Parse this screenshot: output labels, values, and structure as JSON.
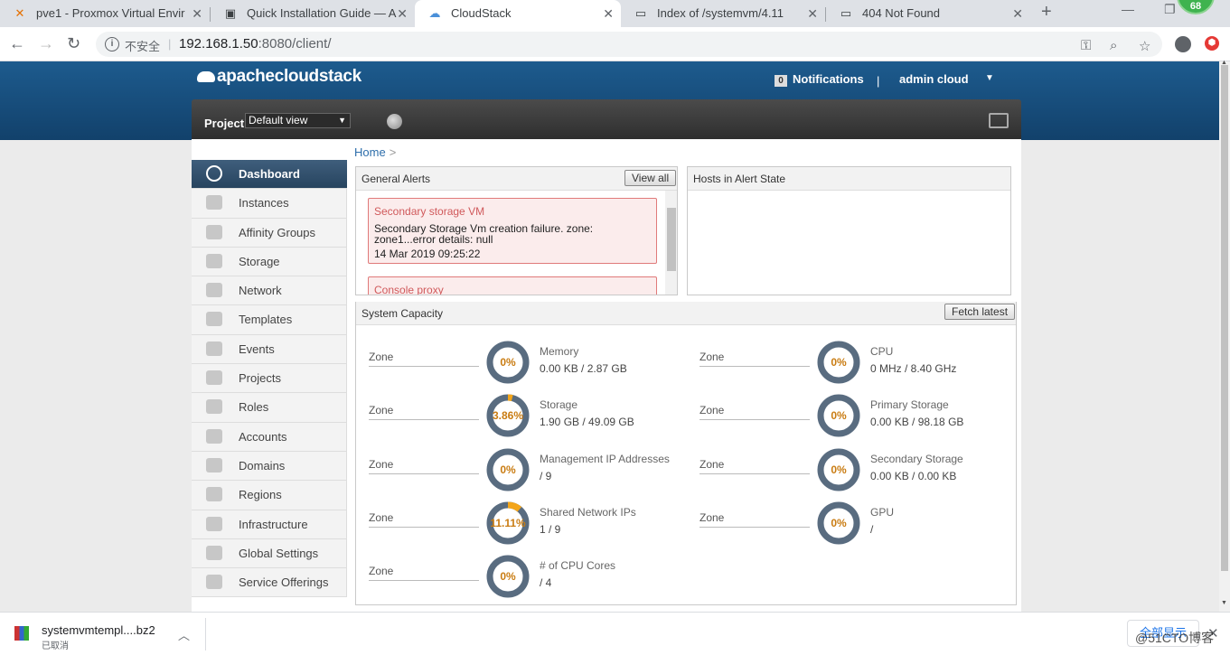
{
  "browser": {
    "tabs": [
      {
        "title": "pve1 - Proxmox Virtual Envir",
        "icon": "proxmox-icon",
        "glyph": "✕"
      },
      {
        "title": "Quick Installation Guide — A",
        "icon": "doc-grid-icon",
        "glyph": "▣"
      },
      {
        "title": "CloudStack",
        "icon": "cloudstack-icon",
        "glyph": "☁"
      },
      {
        "title": "Index of /systemvm/4.11",
        "icon": "page-icon",
        "glyph": "▭"
      },
      {
        "title": "404 Not Found",
        "icon": "page-icon",
        "glyph": "▭"
      }
    ],
    "active_tab": 2,
    "badge": "68",
    "url_security": "不安全",
    "url_host": "192.168.1.50",
    "url_rest": ":8080/client/"
  },
  "header": {
    "logo": "apachecloudstack",
    "notifications_count": "0",
    "notifications_label": "Notifications",
    "divider": "|",
    "user": "admin cloud"
  },
  "toolbar": {
    "project_label": "Project",
    "project_value": "Default view"
  },
  "sidebar": {
    "items": [
      {
        "label": "Dashboard",
        "icon": "dashboard-icon",
        "active": true
      },
      {
        "label": "Instances",
        "icon": "cloud-icon"
      },
      {
        "label": "Affinity Groups",
        "icon": "affinity-icon"
      },
      {
        "label": "Storage",
        "icon": "storage-icon"
      },
      {
        "label": "Network",
        "icon": "network-icon"
      },
      {
        "label": "Templates",
        "icon": "templates-icon"
      },
      {
        "label": "Events",
        "icon": "calendar-icon"
      },
      {
        "label": "Projects",
        "icon": "folder-icon"
      },
      {
        "label": "Roles",
        "icon": "roles-icon"
      },
      {
        "label": "Accounts",
        "icon": "user-icon"
      },
      {
        "label": "Domains",
        "icon": "domains-icon"
      },
      {
        "label": "Regions",
        "icon": "globe-icon"
      },
      {
        "label": "Infrastructure",
        "icon": "infrastructure-icon"
      },
      {
        "label": "Global Settings",
        "icon": "settings-globe-icon"
      },
      {
        "label": "Service Offerings",
        "icon": "gear-icon"
      }
    ]
  },
  "content": {
    "breadcrumb": "Home",
    "breadcrumb_arrow": ">",
    "general_alerts": {
      "title": "General Alerts",
      "view_all": "View all",
      "alerts": [
        {
          "title": "Secondary storage VM",
          "desc": "Secondary Storage Vm creation failure. zone: zone1...error details: null",
          "date": "14 Mar 2019 09:25:22"
        },
        {
          "title": "Console proxy",
          "desc": "",
          "date": ""
        }
      ]
    },
    "hosts_alert": {
      "title": "Hosts in Alert State"
    },
    "capacity": {
      "title": "System Capacity",
      "fetch_latest": "Fetch latest",
      "items": [
        {
          "zone": "Zone",
          "percent": "0%",
          "fraction": 0,
          "name": "Memory",
          "value": "0.00 KB / 2.87 GB"
        },
        {
          "zone": "Zone",
          "percent": "0%",
          "fraction": 0,
          "name": "CPU",
          "value": "0 MHz / 8.40 GHz"
        },
        {
          "zone": "Zone",
          "percent": "3.86%",
          "fraction": 0.0386,
          "name": "Storage",
          "value": "1.90 GB / 49.09 GB"
        },
        {
          "zone": "Zone",
          "percent": "0%",
          "fraction": 0,
          "name": "Primary Storage",
          "value": "0.00 KB / 98.18 GB"
        },
        {
          "zone": "Zone",
          "percent": "0%",
          "fraction": 0,
          "name": "Management IP Addresses",
          "value": "/ 9"
        },
        {
          "zone": "Zone",
          "percent": "0%",
          "fraction": 0,
          "name": "Secondary Storage",
          "value": "0.00 KB / 0.00 KB"
        },
        {
          "zone": "Zone",
          "percent": "11.11%",
          "fraction": 0.1111,
          "name": "Shared Network IPs",
          "value": "1 / 9"
        },
        {
          "zone": "Zone",
          "percent": "0%",
          "fraction": 0,
          "name": "GPU",
          "value": "/"
        },
        {
          "zone": "Zone",
          "percent": "0%",
          "fraction": 0,
          "name": "# of CPU Cores",
          "value": "/ 4"
        }
      ]
    }
  },
  "download": {
    "filename": "systemvmtempl....bz2",
    "status": "已取消",
    "show_all": "全部显示",
    "close": "✕"
  },
  "watermark": "@51CTO博客",
  "colors": {
    "header": "#1d5b8e",
    "active_nav": "#3f5e7c",
    "donut_track": "#596c80",
    "donut_fill": "#f3a51a",
    "alert_border": "#e07a7a"
  }
}
